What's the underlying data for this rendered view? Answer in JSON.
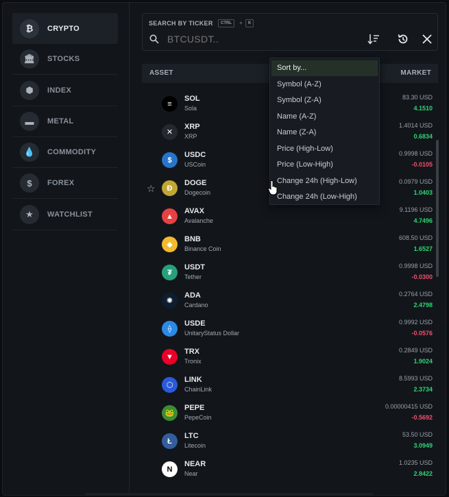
{
  "sidebar": {
    "items": [
      {
        "label": "CRYPTO",
        "icon": "bitcoin-icon",
        "glyph": "₿",
        "active": true
      },
      {
        "label": "STOCKS",
        "icon": "bank-icon",
        "glyph": "🏛",
        "active": false
      },
      {
        "label": "INDEX",
        "icon": "cube-icon",
        "glyph": "⬢",
        "active": false
      },
      {
        "label": "METAL",
        "icon": "gold-bars-icon",
        "glyph": "▬",
        "active": false
      },
      {
        "label": "COMMODITY",
        "icon": "drop-icon",
        "glyph": "💧",
        "active": false
      },
      {
        "label": "FOREX",
        "icon": "dollar-icon",
        "glyph": "$",
        "active": false
      },
      {
        "label": "WATCHLIST",
        "icon": "star-icon",
        "glyph": "★",
        "active": false
      }
    ]
  },
  "search": {
    "title": "SEARCH BY TICKER",
    "kbd_ctrl": "CTRL",
    "kbd_plus": "+",
    "kbd_k": "K",
    "placeholder": "BTCUSDT.."
  },
  "table": {
    "col_asset": "ASSET",
    "col_market": "MARKET",
    "rows": [
      {
        "symbol": "SOL",
        "name": "Sola",
        "price": "83.30 USD",
        "change": "4.1510",
        "dir": "pos",
        "color": "#000000",
        "glyph": "≡",
        "starred": false
      },
      {
        "symbol": "XRP",
        "name": "XRP",
        "price": "1.4014 USD",
        "change": "0.6834",
        "dir": "pos",
        "color": "#23292f",
        "glyph": "✕",
        "starred": false
      },
      {
        "symbol": "USDC",
        "name": "USCoin",
        "price": "0.9998 USD",
        "change": "-0.0105",
        "dir": "neg",
        "color": "#2775ca",
        "glyph": "$",
        "starred": false
      },
      {
        "symbol": "DOGE",
        "name": "Dogecoin",
        "price": "0.0979 USD",
        "change": "1.0403",
        "dir": "pos",
        "color": "#c2a633",
        "glyph": "Ð",
        "starred": true
      },
      {
        "symbol": "AVAX",
        "name": "Avalanche",
        "price": "9.1196 USD",
        "change": "4.7496",
        "dir": "pos",
        "color": "#e84142",
        "glyph": "▲",
        "starred": false
      },
      {
        "symbol": "BNB",
        "name": "Binance Coin",
        "price": "608.50 USD",
        "change": "1.6527",
        "dir": "pos",
        "color": "#f3ba2f",
        "glyph": "◆",
        "starred": false
      },
      {
        "symbol": "USDT",
        "name": "Tether",
        "price": "0.9998 USD",
        "change": "-0.0300",
        "dir": "neg",
        "color": "#26a17b",
        "glyph": "₮",
        "starred": false
      },
      {
        "symbol": "ADA",
        "name": "Cardano",
        "price": "0.2764 USD",
        "change": "2.4798",
        "dir": "pos",
        "color": "#0d1e30",
        "glyph": "✺",
        "starred": false
      },
      {
        "symbol": "USDE",
        "name": "UnitaryStatus Dollar",
        "price": "0.9992 USD",
        "change": "-0.0576",
        "dir": "neg",
        "color": "#2b8ae6",
        "glyph": "⟠",
        "starred": false
      },
      {
        "symbol": "TRX",
        "name": "Tronix",
        "price": "0.2849 USD",
        "change": "1.9024",
        "dir": "pos",
        "color": "#eb0029",
        "glyph": "▼",
        "starred": false
      },
      {
        "symbol": "LINK",
        "name": "ChainLink",
        "price": "8.5993 USD",
        "change": "2.3734",
        "dir": "pos",
        "color": "#2a5ada",
        "glyph": "⬡",
        "starred": false
      },
      {
        "symbol": "PEPE",
        "name": "PepeCoin",
        "price": "0.00000415 USD",
        "change": "-0.5692",
        "dir": "neg",
        "color": "#3d8b37",
        "glyph": "🐸",
        "starred": false
      },
      {
        "symbol": "LTC",
        "name": "Litecoin",
        "price": "53.50 USD",
        "change": "3.0949",
        "dir": "pos",
        "color": "#345d9d",
        "glyph": "Ł",
        "starred": false
      },
      {
        "symbol": "NEAR",
        "name": "Near",
        "price": "1.0235 USD",
        "change": "2.8422",
        "dir": "pos",
        "color": "#ffffff",
        "glyph": "N",
        "starred": false
      }
    ]
  },
  "sort_menu": {
    "items": [
      "Sort by...",
      "Symbol (A-Z)",
      "Symbol (Z-A)",
      "Name (A-Z)",
      "Name (Z-A)",
      "Price (High-Low)",
      "Price (Low-High)",
      "Change 24h (High-Low)",
      "Change 24h (Low-High)"
    ],
    "active_index": 0
  }
}
